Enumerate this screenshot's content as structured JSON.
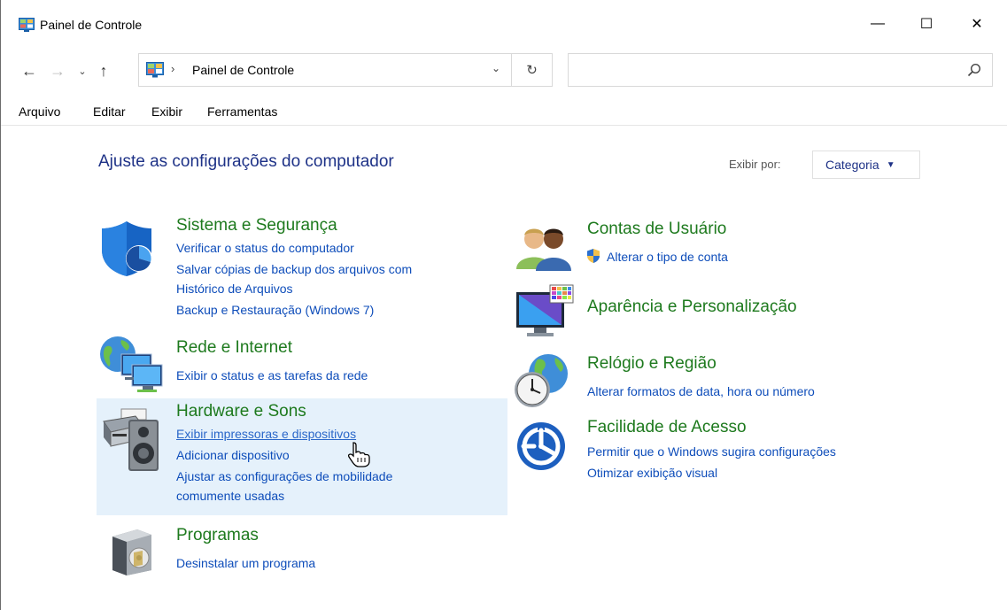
{
  "window": {
    "title": "Painel de Controle",
    "controls": {
      "minimize": "—",
      "maximize": "☐",
      "close": "✕"
    }
  },
  "nav": {
    "back": "←",
    "forward": "→",
    "recent": "⌄",
    "up": "↑",
    "address_separator": "›",
    "address": "Painel de Controle",
    "address_dropdown": "⌄",
    "refresh": "↻",
    "search_placeholder": ""
  },
  "menu": [
    "Arquivo",
    "Editar",
    "Exibir",
    "Ferramentas"
  ],
  "content": {
    "heading": "Ajuste as configurações do computador",
    "view_by_label": "Exibir por:",
    "view_by_value": "Categoria",
    "view_by_arrow": "▼"
  },
  "categories": {
    "sistema": {
      "title": "Sistema e Segurança",
      "links": [
        "Verificar o status do computador",
        "Salvar cópias de backup dos arquivos com",
        "Histórico de Arquivos",
        "Backup e Restauração (Windows 7)"
      ]
    },
    "rede": {
      "title": "Rede e Internet",
      "links": [
        "Exibir o status e as tarefas da rede"
      ]
    },
    "hardware": {
      "title": "Hardware e Sons",
      "links": [
        "Exibir impressoras e dispositivos",
        "Adicionar dispositivo",
        "Ajustar as configurações de mobilidade",
        "comumente usadas"
      ]
    },
    "programas": {
      "title": "Programas",
      "links": [
        "Desinstalar um programa"
      ]
    },
    "contas": {
      "title": "Contas de Usuário",
      "links": [
        "Alterar o tipo de conta"
      ]
    },
    "aparencia": {
      "title": "Aparência e Personalização",
      "links": []
    },
    "relogio": {
      "title": "Relógio e Região",
      "links": [
        "Alterar formatos de data, hora ou número"
      ]
    },
    "facilidade": {
      "title": "Facilidade de Acesso",
      "links": [
        "Permitir que o Windows sugira configurações",
        "Otimizar exibição visual"
      ]
    }
  },
  "colors": {
    "heading": "#1e3287",
    "category_title": "#1e7a1e",
    "link": "#0e4dba",
    "hover_bg": "#e5f1fb"
  }
}
